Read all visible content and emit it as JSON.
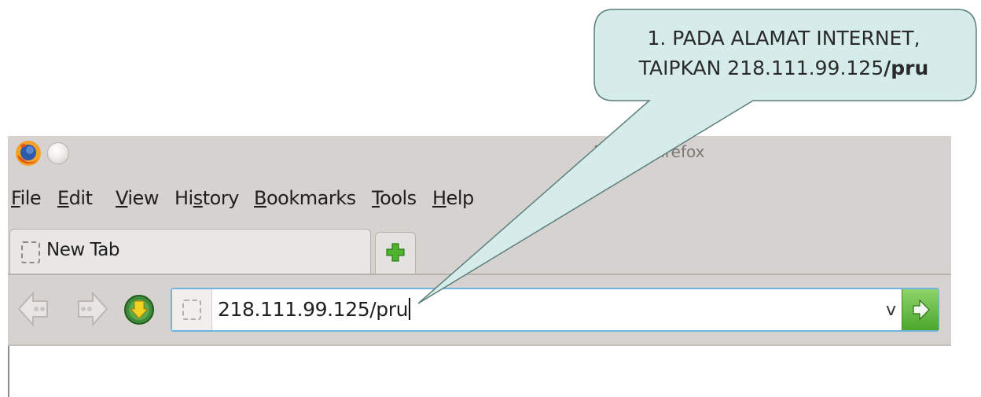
{
  "window": {
    "title": "Mozilla Firefox"
  },
  "menu": [
    {
      "pre": "",
      "key": "F",
      "post": "ile"
    },
    {
      "pre": "",
      "key": "E",
      "post": "dit"
    },
    {
      "pre": "",
      "key": "V",
      "post": "iew"
    },
    {
      "pre": "Hi",
      "key": "s",
      "post": "tory"
    },
    {
      "pre": "",
      "key": "B",
      "post": "ookmarks"
    },
    {
      "pre": "",
      "key": "T",
      "post": "ools"
    },
    {
      "pre": "",
      "key": "H",
      "post": "elp"
    }
  ],
  "tabs": [
    {
      "label": "New Tab"
    }
  ],
  "urlbar": {
    "value": "218.111.99.125/pru",
    "dropdown_glyph": "v"
  },
  "callout": {
    "line1": "1. PADA ALAMAT INTERNET,",
    "line2_prefix": "TAIPKAN 218.111.99.125",
    "line2_bold": "/pru"
  },
  "icons": {
    "app": "firefox-logo-icon",
    "new_tab": "plus-icon",
    "back": "back-arrow-icon",
    "forward": "forward-arrow-icon",
    "home": "home-arrow-icon",
    "go": "go-arrow-icon"
  },
  "colors": {
    "chrome": "#d5d2cf",
    "callout_fill": "#d6ecea",
    "urlbar_border": "#6fb3e0",
    "go_button": "#4aa72c"
  }
}
